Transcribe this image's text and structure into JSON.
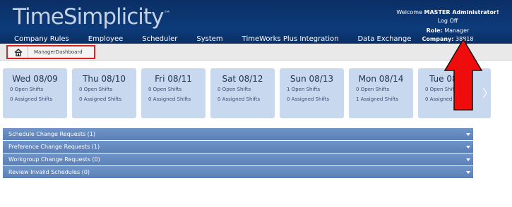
{
  "header": {
    "logo_main": "TimeSimplicity",
    "logo_mark": "™",
    "nav": [
      "Company Rules",
      "Employee",
      "Scheduler",
      "System",
      "TimeWorks Plus Integration",
      "Data Exchange"
    ],
    "welcome_prefix": "Welcome ",
    "welcome_user": "MASTER Administrator!",
    "logoff": "Log Off",
    "role_label": "Role:",
    "role_value": "Manager",
    "company_label": "Company:",
    "company_value": "38818"
  },
  "breadcrumb": {
    "home_icon": "home-icon",
    "current": "ManagerDashboard"
  },
  "days": [
    {
      "label": "Wed 08/09",
      "open": "0 Open Shifts",
      "assigned": "0 Assigned Shifts"
    },
    {
      "label": "Thu 08/10",
      "open": "0 Open Shifts",
      "assigned": "0 Assigned Shifts"
    },
    {
      "label": "Fri 08/11",
      "open": "0 Open Shifts",
      "assigned": "0 Assigned Shifts"
    },
    {
      "label": "Sat 08/12",
      "open": "0 Open Shifts",
      "assigned": "0 Assigned Shifts"
    },
    {
      "label": "Sun 08/13",
      "open": "1 Open Shifts",
      "assigned": "0 Assigned Shifts"
    },
    {
      "label": "Mon 08/14",
      "open": "0 Open Shifts",
      "assigned": "1 Assigned Shifts"
    },
    {
      "label": "Tue 08/15",
      "open": "0 Open Shifts",
      "assigned": "0 Assigned Shifts"
    }
  ],
  "requests": [
    "Schedule Change Requests (1)",
    "Preference Change Requests (1)",
    "Workgroup Change Requests (0)",
    "Review Invalid Schedules (0)"
  ],
  "colors": {
    "header_bg": "#0d3b7a",
    "day_card": "#c7d8ef",
    "accordion": "#6489c0",
    "highlight": "#e02020"
  }
}
